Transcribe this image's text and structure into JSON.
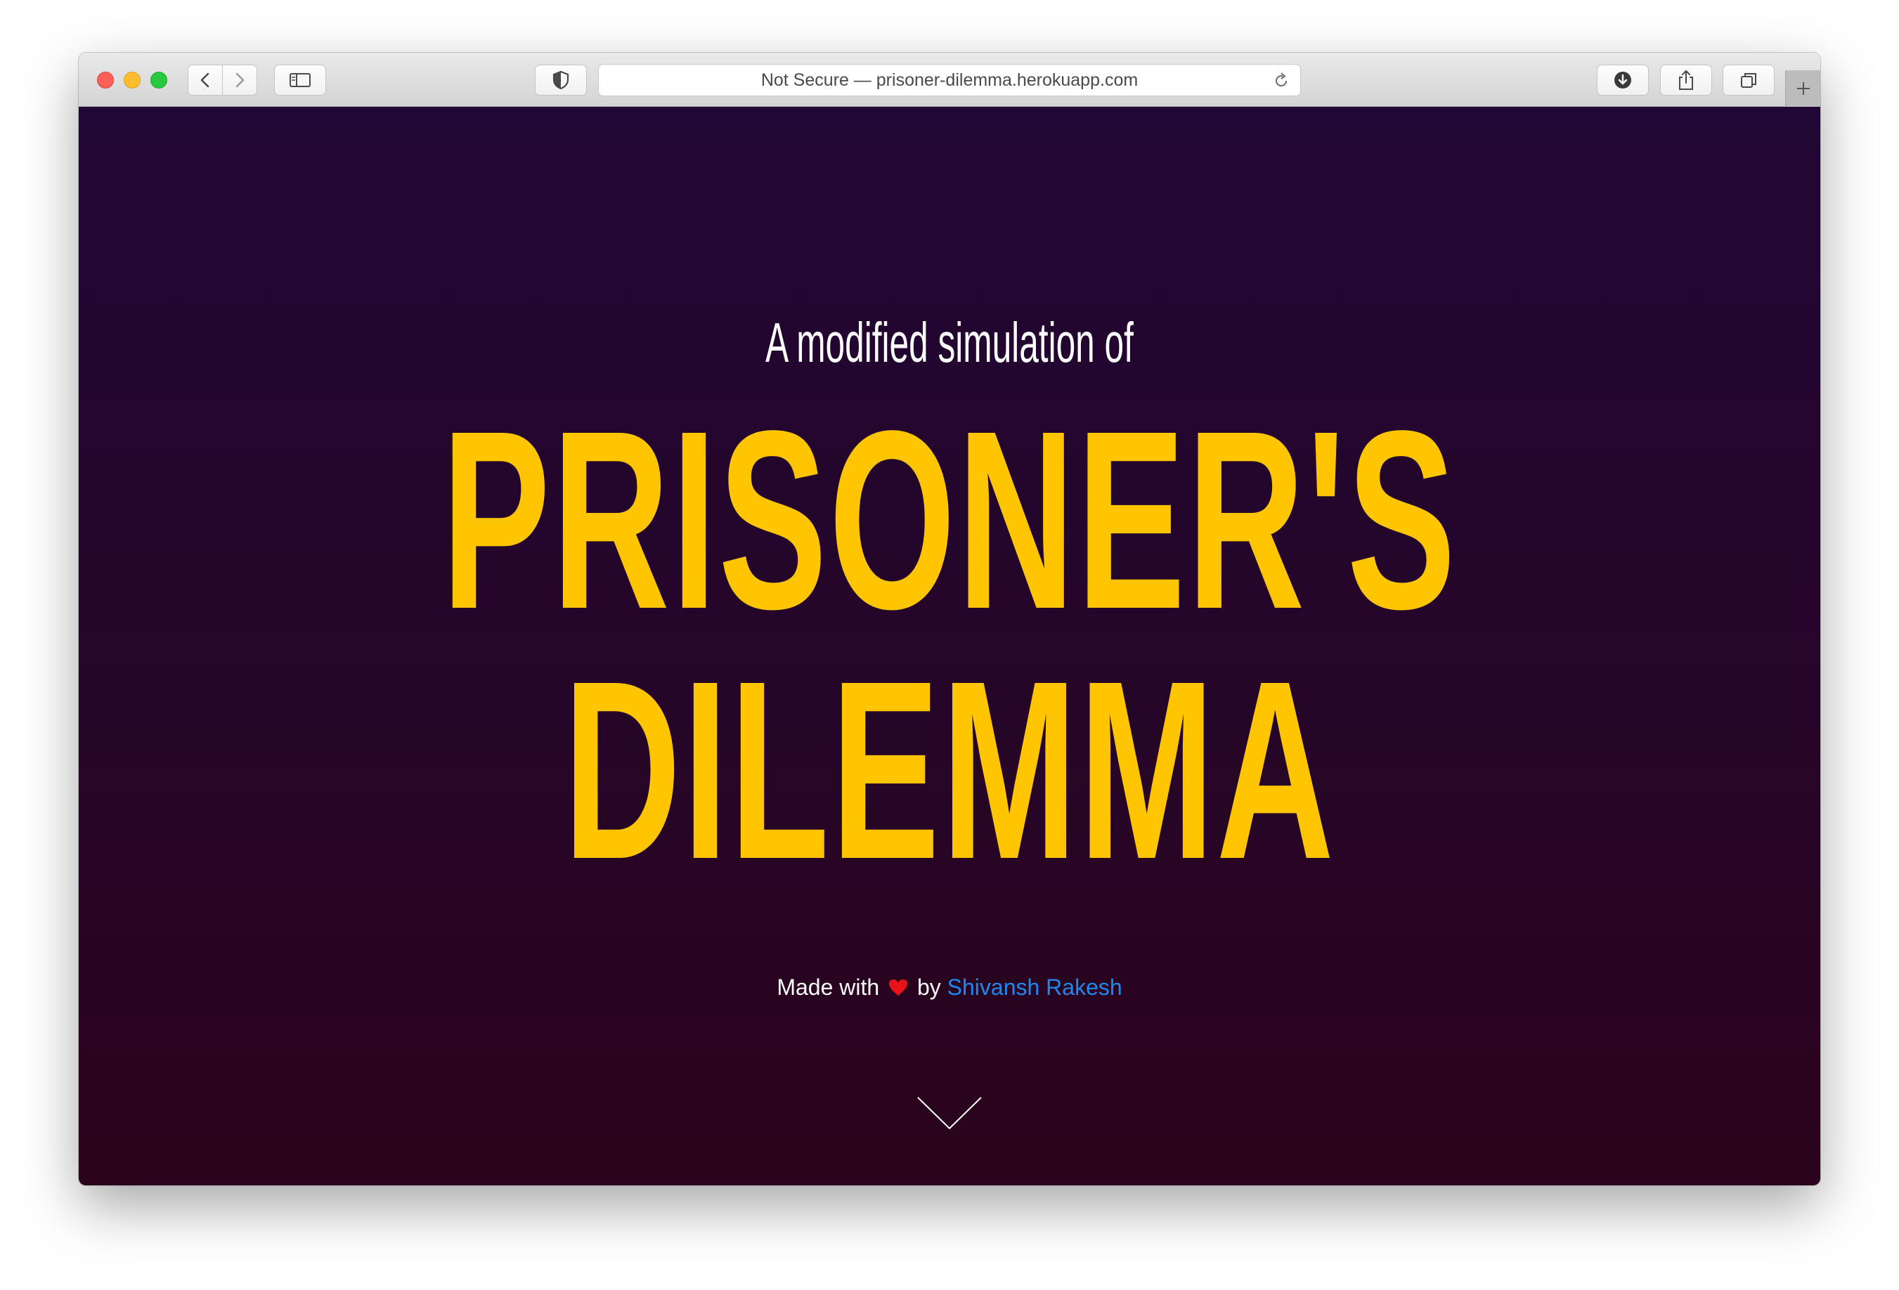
{
  "browser": {
    "address_text": "Not Secure — prisoner-dilemma.herokuapp.com"
  },
  "page": {
    "kicker": "A modified simulation of",
    "title_line1": "PRISONER'S",
    "title_line2": "DILEMMA",
    "credit_prefix": "Made with",
    "credit_middle": "by",
    "author": "Shivansh Rakesh",
    "colors": {
      "background_top": "#210735",
      "background_bottom": "#2b031c",
      "title": "#ffc600",
      "author_link": "#1e88f0",
      "heart": "#e8121b"
    }
  },
  "icons": [
    "close-icon",
    "minimize-icon",
    "zoom-icon",
    "back-icon",
    "forward-icon",
    "sidebar-icon",
    "shield-icon",
    "reload-icon",
    "download-icon",
    "share-icon",
    "tabs-icon",
    "plus-icon",
    "heart-icon",
    "chevron-down-icon"
  ]
}
